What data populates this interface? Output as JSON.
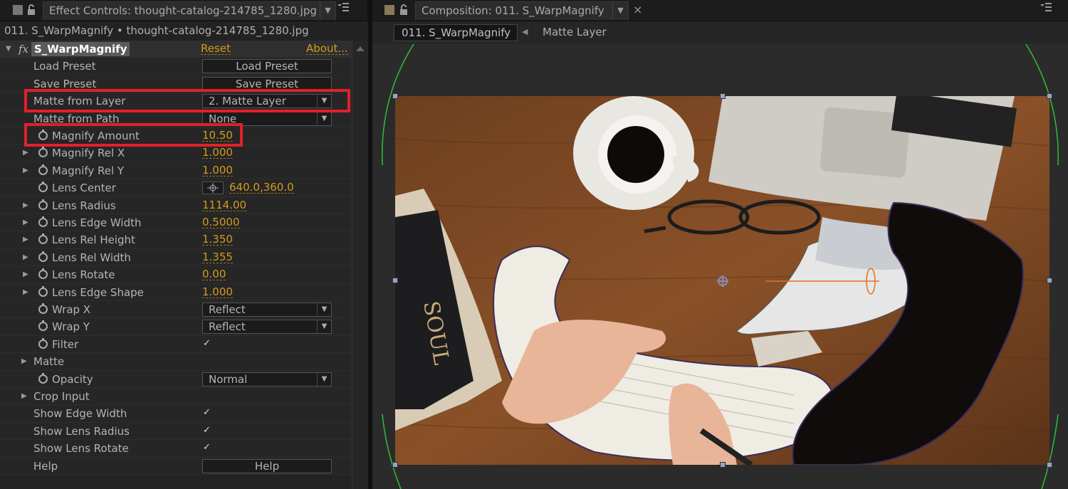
{
  "left_panel": {
    "tab_title": "Effect Controls: thought-catalog-214785_1280.jpg",
    "header": "011. S_WarpMagnify • thought-catalog-214785_1280.jpg",
    "effect": {
      "name": "S_WarpMagnify",
      "reset": "Reset",
      "about": "About...",
      "fx_icon": "fx"
    },
    "rows": [
      {
        "label": "Load Preset",
        "kind": "button",
        "value": "Load Preset"
      },
      {
        "label": "Save Preset",
        "kind": "button",
        "value": "Save Preset"
      },
      {
        "label": "Matte from Layer",
        "kind": "select",
        "value": "2. Matte Layer"
      },
      {
        "label": "Matte from Path",
        "kind": "select",
        "value": "None"
      },
      {
        "label": "Magnify Amount",
        "kind": "value",
        "value": "10.50"
      },
      {
        "label": "Magnify Rel X",
        "kind": "value",
        "value": "1.000"
      },
      {
        "label": "Magnify Rel Y",
        "kind": "value",
        "value": "1.000"
      },
      {
        "label": "Lens Center",
        "kind": "point",
        "value": "640.0,360.0"
      },
      {
        "label": "Lens Radius",
        "kind": "value",
        "value": "1114.00"
      },
      {
        "label": "Lens Edge Width",
        "kind": "value",
        "value": "0.5000"
      },
      {
        "label": "Lens Rel Height",
        "kind": "value",
        "value": "1.350"
      },
      {
        "label": "Lens Rel Width",
        "kind": "value",
        "value": "1.355"
      },
      {
        "label": "Lens Rotate",
        "kind": "value",
        "value": "0.00"
      },
      {
        "label": "Lens Edge Shape",
        "kind": "value",
        "value": "1.000"
      },
      {
        "label": "Wrap X",
        "kind": "select",
        "value": "Reflect"
      },
      {
        "label": "Wrap Y",
        "kind": "select",
        "value": "Reflect"
      },
      {
        "label": "Filter",
        "kind": "check",
        "value": "✓"
      },
      {
        "label": "Matte",
        "kind": "group",
        "value": ""
      },
      {
        "label": "Opacity",
        "kind": "select",
        "value": "Normal"
      },
      {
        "label": "Crop Input",
        "kind": "group",
        "value": ""
      },
      {
        "label": "Show Edge Width",
        "kind": "check",
        "value": "✓"
      },
      {
        "label": "Show Lens Radius",
        "kind": "check",
        "value": "✓"
      },
      {
        "label": "Show Lens Rotate",
        "kind": "check",
        "value": "✓"
      },
      {
        "label": "Help",
        "kind": "button",
        "value": "Help"
      }
    ]
  },
  "right_panel": {
    "tab_title": "Composition: 011. S_WarpMagnify",
    "breadcrumb_active": "011. S_WarpMagnify",
    "breadcrumb_next": "Matte Layer",
    "close_glyph": "×"
  },
  "icons": [
    "lock-icon",
    "panel-menu-icon",
    "stopwatch-icon",
    "twirl-triangle-icon",
    "checkbox-icon",
    "crosshair-icon"
  ],
  "colors": {
    "accent": "#d29b1e",
    "highlight_box": "#e1202a",
    "lens_outline": "#2fbf3a"
  }
}
